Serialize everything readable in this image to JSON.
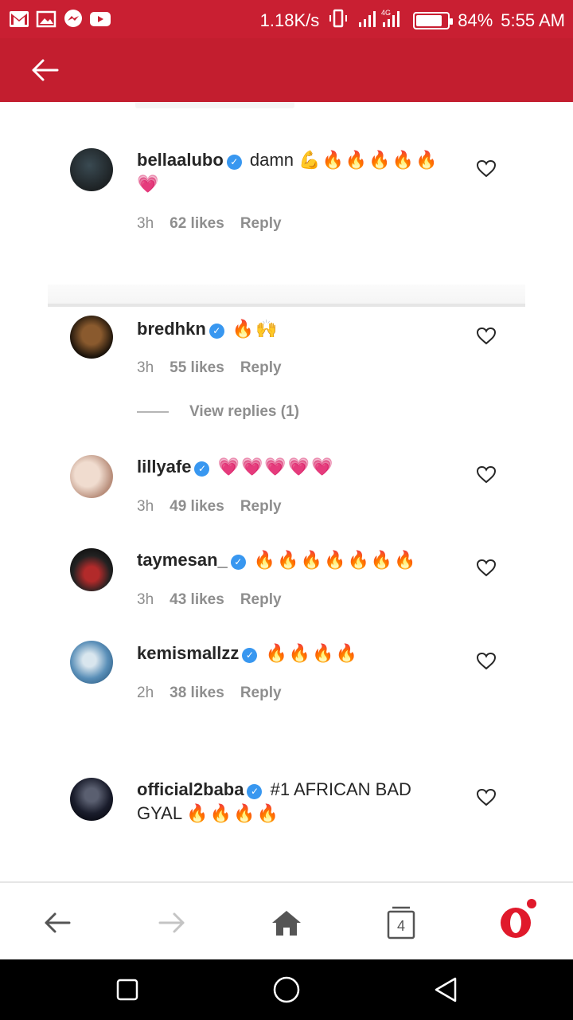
{
  "status_bar": {
    "speed": "1.18K/s",
    "network": "4G",
    "battery": "84%",
    "battery_level": 0.84,
    "time": "5:55 AM",
    "icons": [
      "gmail-icon",
      "gallery-icon",
      "messenger-icon",
      "youtube-icon",
      "vibrate-icon",
      "signal-icon",
      "battery-icon"
    ]
  },
  "appbar": {
    "back_icon": "arrow-left-icon"
  },
  "comments": [
    {
      "username": "bellaalubo",
      "text": "damn",
      "emoji": "💪🔥🔥🔥🔥🔥",
      "emoji2": "💗",
      "time": "3h",
      "likes": "62 likes",
      "reply": "Reply",
      "avatar_color": "#1b2226"
    },
    {
      "username": "bredhkn",
      "text": "",
      "emoji": "🔥🙌",
      "time": "3h",
      "likes": "55 likes",
      "reply": "Reply",
      "avatar_color": "#2a1a10"
    },
    {
      "username": "lillyafe",
      "text": "",
      "emoji": "💗💗💗💗💗",
      "time": "3h",
      "likes": "49 likes",
      "reply": "Reply",
      "avatar_color": "#d8c2b6"
    },
    {
      "username": "taymesan_",
      "text": "",
      "emoji": "🔥🔥🔥🔥🔥🔥🔥",
      "time": "3h",
      "likes": "43 likes",
      "reply": "Reply",
      "avatar_color": "#1a1a1a"
    },
    {
      "username": "kemismallzz",
      "text": "",
      "emoji": "🔥🔥🔥🔥",
      "time": "2h",
      "likes": "38 likes",
      "reply": "Reply",
      "avatar_color": "#5a8fb8"
    },
    {
      "username": "official2baba",
      "text": "#1 AFRICAN BAD GYAL",
      "emoji": "🔥🔥🔥🔥",
      "avatar_color": "#0f1220"
    }
  ],
  "view_replies": "View replies (1)",
  "browser_nav": {
    "tabs_count": "4"
  },
  "colors": {
    "brand_red": "#c31e2f",
    "verified_blue": "#3897f0",
    "meta_gray": "#8e8e8e"
  }
}
